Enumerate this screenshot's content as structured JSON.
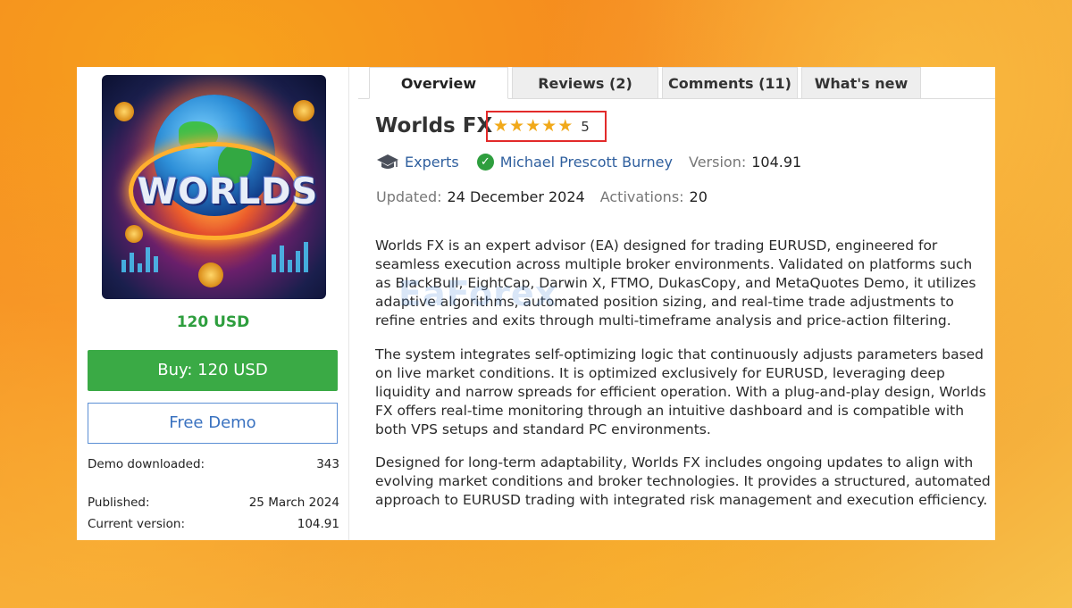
{
  "left": {
    "price": "120 USD",
    "buy_label": "Buy: 120 USD",
    "demo_label": "Free Demo",
    "stats": [
      {
        "label": "Demo downloaded:",
        "value": "343"
      },
      {
        "label": "Published:",
        "value": "25 March 2024"
      },
      {
        "label": "Current version:",
        "value": "104.91"
      }
    ],
    "image_text": "WORLDS"
  },
  "tabs": [
    {
      "label": "Overview"
    },
    {
      "label": "Reviews (2)"
    },
    {
      "label": "Comments (11)"
    },
    {
      "label": "What's new"
    }
  ],
  "product": {
    "title": "Worlds FX",
    "rating": "5",
    "stars": 5,
    "category": "Experts",
    "author": "Michael Prescott Burney",
    "version_label": "Version:",
    "version": "104.91",
    "updated_label": "Updated:",
    "updated": "24 December 2024",
    "activations_label": "Activations:",
    "activations": "20"
  },
  "description": [
    "Worlds FX is an expert advisor (EA) designed for trading EURUSD, engineered for seamless execution across multiple broker environments. Validated on platforms such as BlackBull, EightCap, Darwin X, FTMO, DukasCopy, and MetaQuotes Demo, it utilizes adaptive algorithms, automated position sizing, and real-time trade adjustments to refine entries and exits through multi-timeframe analysis and price-action filtering.",
    "The system integrates self-optimizing logic that continuously adjusts parameters based on live market conditions. It is optimized exclusively for EURUSD, leveraging deep liquidity and narrow spreads for efficient operation. With a plug-and-play design, Worlds FX offers real-time monitoring through an intuitive dashboard and is compatible with both VPS setups and standard PC environments.",
    "Designed for long-term adaptability, Worlds FX includes ongoing updates to align with evolving market conditions and broker technologies. It provides a structured, automated approach to EURUSD trading with integrated risk management and execution efficiency."
  ],
  "watermark": "EaForex",
  "colors": {
    "price_green": "#2e9e3e",
    "buy_green": "#3aaa45",
    "link_blue": "#2f5f9e",
    "star_gold": "#f1a91a",
    "highlight_red": "#e22a2a"
  },
  "icons": {
    "category": "graduation-cap-icon",
    "verified": "verified-check-icon",
    "star": "star-icon"
  }
}
